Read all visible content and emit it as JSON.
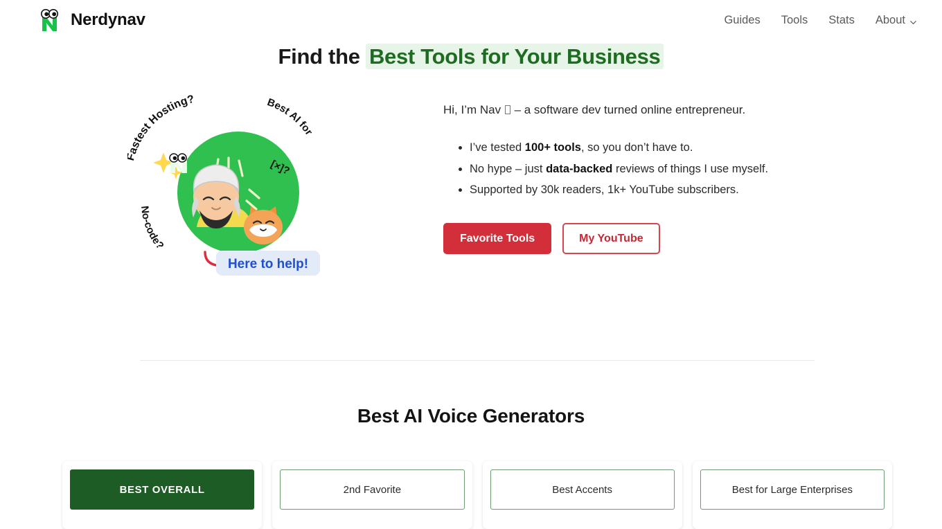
{
  "header": {
    "brand_name": "Nerdynav",
    "logo_icon": "nerdynav-n-eyes-logo",
    "nav": [
      {
        "label": "Guides",
        "icon": ""
      },
      {
        "label": "Tools",
        "icon": ""
      },
      {
        "label": "Stats",
        "icon": ""
      },
      {
        "label": "About",
        "icon": "chevron-down-icon"
      }
    ]
  },
  "hero": {
    "title_plain": "Find the ",
    "title_highlight": "Best Tools for Your Business",
    "intro_before": "Hi, I’m Nav ",
    "intro_after": " – a software dev turned online entrepreneur.",
    "bullets": [
      {
        "before": "I’ve tested ",
        "bold": "100+ tools",
        "after": ", so you don’t have to."
      },
      {
        "before": "No hype – just ",
        "bold": "data-backed",
        "after": " reviews of things I use myself."
      },
      {
        "before": "Supported by 30k readers, 1k+ YouTube subscribers.",
        "bold": "",
        "after": ""
      }
    ],
    "buttons": {
      "primary": "Favorite Tools",
      "secondary": "My YouTube"
    },
    "illustration": {
      "label_top_left": "Fastest Hosting?",
      "label_top_right_line1": "Best AI for",
      "label_top_right_line2": "[×]?",
      "label_bottom_left": "No-code?",
      "speech_bubble": "Here to help!",
      "circle_color": "#2fc04f",
      "bubble_text_color": "#1f4fd8",
      "bubble_bg_color": "#e3eaf8",
      "arrow_color": "#e02b3c"
    }
  },
  "section": {
    "title": "Best AI Voice Generators",
    "cards": [
      {
        "badge": "BEST OVERALL",
        "style": "filled"
      },
      {
        "badge": "2nd Favorite",
        "style": "outline"
      },
      {
        "badge": "Best Accents",
        "style": "outline"
      },
      {
        "badge": "Best for Large Enterprises",
        "style": "outline"
      }
    ]
  },
  "colors": {
    "brand_green": "#2fc04f",
    "dark_green": "#1e5c25",
    "highlight_bg": "#e7f4e8",
    "highlight_text": "#1e6b22",
    "cta_red": "#d32f3a"
  }
}
